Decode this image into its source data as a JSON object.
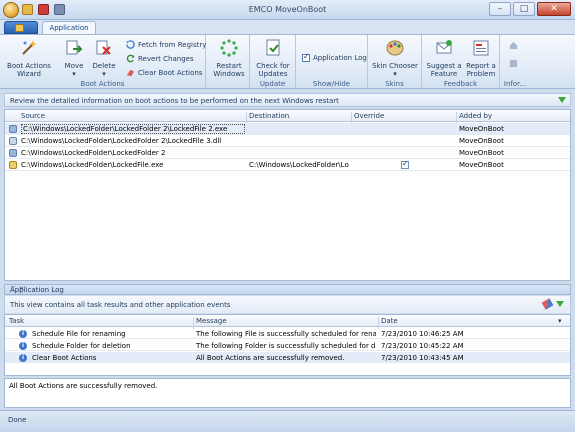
{
  "window": {
    "title": "EMCO MoveOnBoot"
  },
  "tabs": {
    "application": "Application"
  },
  "ribbon": {
    "groups": {
      "boot_actions": "Boot Actions",
      "update": "Update",
      "show_hide": "Show/Hide",
      "skins": "Skins",
      "feedback": "Feedback",
      "info": "Infor..."
    },
    "buttons": {
      "wizard": [
        "Boot Actions",
        "Wizard"
      ],
      "move": "Move",
      "delete": "Delete",
      "fetch": "Fetch from Registry",
      "revert": "Revert Changes",
      "clear": "Clear Boot Actions",
      "restart": [
        "Restart",
        "Windows"
      ],
      "check_updates": [
        "Check for",
        "Updates"
      ],
      "app_log": "Application Log",
      "skin_chooser": "Skin Chooser",
      "suggest": [
        "Suggest a",
        "Feature"
      ],
      "report": [
        "Report a",
        "Problem"
      ]
    }
  },
  "info_text": "Review the detailed information on boot actions to be performed on the next Windows restart",
  "grid": {
    "columns": {
      "source": "Source",
      "destination": "Destination",
      "override": "Override",
      "added_by": "Added by"
    },
    "rows": [
      {
        "source": "C:\\Windows\\LockedFolder\\LockedFolder 2\\LockedFile 2.exe",
        "destination": "",
        "override": false,
        "added_by": "MoveOnBoot"
      },
      {
        "source": "C:\\Windows\\LockedFolder\\LockedFolder 2\\LockedFile 3.dll",
        "destination": "",
        "override": false,
        "added_by": "MoveOnBoot"
      },
      {
        "source": "C:\\Windows\\LockedFolder\\LockedFolder 2",
        "destination": "",
        "override": false,
        "added_by": "MoveOnBoot"
      },
      {
        "source": "C:\\Windows\\LockedFolder\\LockedFile.exe",
        "destination": "C:\\Windows\\LockedFolder\\Loc...",
        "override": true,
        "added_by": "MoveOnBoot"
      }
    ]
  },
  "log": {
    "title": "Application Log",
    "subtitle": "This view contains all task results and other application events",
    "columns": {
      "task": "Task",
      "message": "Message",
      "date": "Date"
    },
    "rows": [
      {
        "task": "Schedule File for renaming",
        "message": "The following File is successfully scheduled for renaming: ...",
        "date": "7/23/2010 10:46:25 AM"
      },
      {
        "task": "Schedule Folder for deletion",
        "message": "The following Folder is successfully scheduled for deletio...",
        "date": "7/23/2010 10:45:22 AM"
      },
      {
        "task": "Clear Boot Actions",
        "message": "All Boot Actions are successfully removed.",
        "date": "7/23/2010 10:43:45 AM"
      }
    ],
    "detail": "All Boot Actions are successfully removed."
  },
  "status": {
    "text": "Done"
  },
  "colors": {
    "ribbon_bg": "#e3ecf7",
    "accent": "#15428b",
    "selection": "#e3ecf8"
  }
}
